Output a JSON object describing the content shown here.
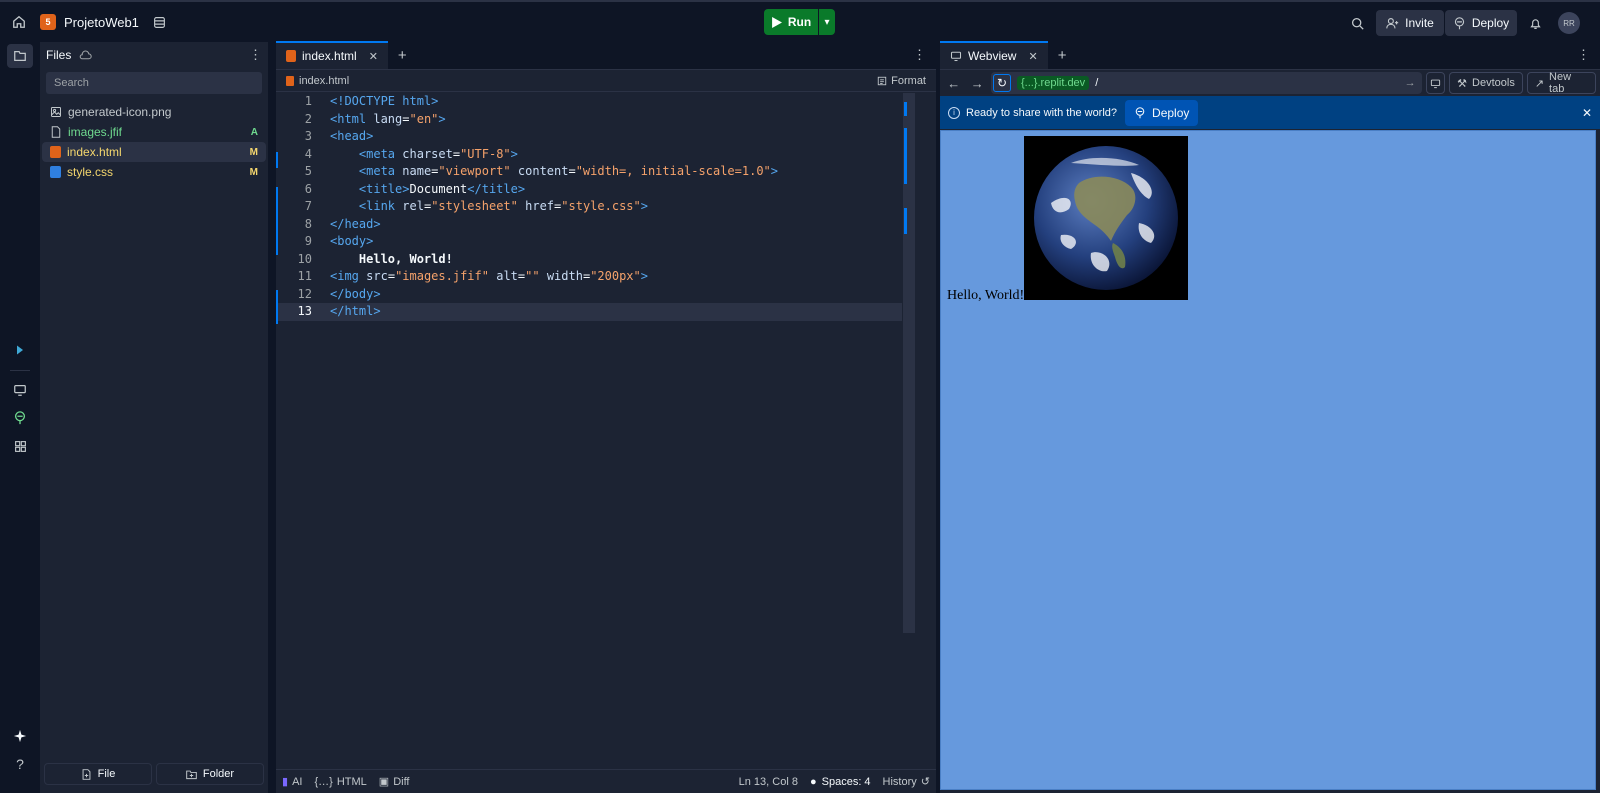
{
  "topbar": {
    "project_name": "ProjetoWeb1",
    "run_label": "Run",
    "invite_label": "Invite",
    "deploy_label": "Deploy",
    "avatar_initials": "RR"
  },
  "files": {
    "title": "Files",
    "search_placeholder": "Search",
    "items": [
      {
        "name": "generated-icon.png",
        "badge": "",
        "color": "#c2c8cc"
      },
      {
        "name": "images.jfif",
        "badge": "A",
        "color": "#6fda8f"
      },
      {
        "name": "index.html",
        "badge": "M",
        "color": "#f5d76e"
      },
      {
        "name": "style.css",
        "badge": "M",
        "color": "#f5d76e"
      }
    ],
    "new_file_label": "File",
    "new_folder_label": "Folder"
  },
  "editor": {
    "tab_label": "index.html",
    "breadcrumb": "index.html",
    "format_label": "Format",
    "lines": [
      "<!DOCTYPE html>",
      "<html lang=\"en\">",
      "<head>",
      "    <meta charset=\"UTF-8\">",
      "    <meta name=\"viewport\" content=\"width=, initial-scale=1.0\">",
      "    <title>Document</title>",
      "    <link rel=\"stylesheet\" href=\"style.css\">",
      "</head>",
      "<body>",
      "    Hello, World!",
      "<img src=\"images.jfif\" alt=\"\" width=\"200px\">",
      "</body>",
      "</html>"
    ],
    "status": {
      "ai": "AI",
      "lang": "HTML",
      "diff": "Diff",
      "position": "Ln 13, Col 8",
      "spaces": "Spaces: 4",
      "history": "History"
    }
  },
  "webview": {
    "tab_label": "Webview",
    "url_host": "{...}.replit.dev",
    "url_path": "/",
    "devtools_label": "Devtools",
    "newtab_label": "New tab",
    "banner_text": "Ready to share with the world?",
    "banner_deploy": "Deploy",
    "page_text": "Hello, World!",
    "page_bg": "#6699dd"
  },
  "colors": {
    "accent": "#0079f2",
    "run_green": "#0a7a2a",
    "banner_blue": "#004182"
  }
}
